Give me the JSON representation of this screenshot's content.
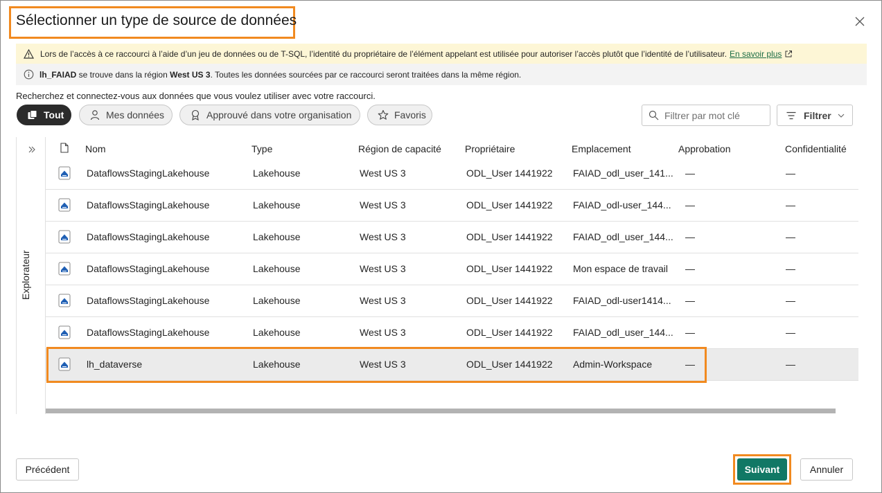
{
  "dialog": {
    "title": "Sélectionner un type de source de données",
    "close_icon": "close-icon"
  },
  "banners": {
    "warning": {
      "icon": "warning-icon",
      "text": "Lors de l’accès à ce raccourci à l’aide d’un jeu de données ou de T-SQL, l’identité du propriétaire de l’élément appelant est utilisée pour autoriser l’accès plutôt que l’identité de l’utilisateur.",
      "link_label": "En savoir plus",
      "link_icon": "open-external-icon"
    },
    "info": {
      "icon": "info-icon",
      "bold_name": "lh_FAIAD",
      "text_1": " se trouve dans la région ",
      "bold_region": "West US 3",
      "text_2": ". Toutes les données sourcées par ce raccourci seront traitées dans la même région."
    }
  },
  "search_hint": "Recherchez et connectez-vous aux données que vous voulez utiliser avec votre raccourci.",
  "pills": [
    {
      "label": "Tout",
      "icon": "stack-icon",
      "active": true
    },
    {
      "label": "Mes données",
      "icon": "person-icon",
      "active": false
    },
    {
      "label": "Approuvé dans votre organisation",
      "icon": "ribbon-icon",
      "active": false
    },
    {
      "label": "Favoris",
      "icon": "star-icon",
      "active": false
    }
  ],
  "filter": {
    "placeholder": "Filtrer par mot clé",
    "button_label": "Filtrer"
  },
  "explorer": {
    "label": "Explorateur",
    "expand_icon": "double-chevron-right-icon"
  },
  "table": {
    "columns": [
      "Nom",
      "Type",
      "Région de capacité",
      "Propriétaire",
      "Emplacement",
      "Approbation",
      "Confidentialité"
    ],
    "rows": [
      {
        "name": "DataflowsStagingLakehouse",
        "type": "Lakehouse",
        "region": "West US 3",
        "owner": "ODL_User 1441922",
        "location": "FAIAD_odl_user_141...",
        "endorsement": "—",
        "sensitivity": "—",
        "selected": false
      },
      {
        "name": "DataflowsStagingLakehouse",
        "type": "Lakehouse",
        "region": "West US 3",
        "owner": "ODL_User 1441922",
        "location": "FAIAD_odl-user_144...",
        "endorsement": "—",
        "sensitivity": "—",
        "selected": false
      },
      {
        "name": "DataflowsStagingLakehouse",
        "type": "Lakehouse",
        "region": "West US 3",
        "owner": "ODL_User 1441922",
        "location": "FAIAD_odl_user_144...",
        "endorsement": "—",
        "sensitivity": "—",
        "selected": false
      },
      {
        "name": "DataflowsStagingLakehouse",
        "type": "Lakehouse",
        "region": "West US 3",
        "owner": "ODL_User 1441922",
        "location": "Mon espace de travail",
        "endorsement": "—",
        "sensitivity": "—",
        "selected": false
      },
      {
        "name": "DataflowsStagingLakehouse",
        "type": "Lakehouse",
        "region": "West US 3",
        "owner": "ODL_User 1441922",
        "location": "FAIAD_odl-user1414...",
        "endorsement": "—",
        "sensitivity": "—",
        "selected": false
      },
      {
        "name": "DataflowsStagingLakehouse",
        "type": "Lakehouse",
        "region": "West US 3",
        "owner": "ODL_User 1441922",
        "location": "FAIAD_odl_user_144...",
        "endorsement": "—",
        "sensitivity": "—",
        "selected": false
      },
      {
        "name": "lh_dataverse",
        "type": "Lakehouse",
        "region": "West US 3",
        "owner": "ODL_User 1441922",
        "location": "Admin-Workspace",
        "endorsement": "—",
        "sensitivity": "—",
        "selected": true
      }
    ]
  },
  "footer": {
    "previous_label": "Précédent",
    "next_label": "Suivant",
    "cancel_label": "Annuler"
  },
  "colors": {
    "accent": "#117865",
    "highlight": "#f18a20",
    "warning_bg": "#fdf6d6",
    "link": "#1b6c44"
  }
}
